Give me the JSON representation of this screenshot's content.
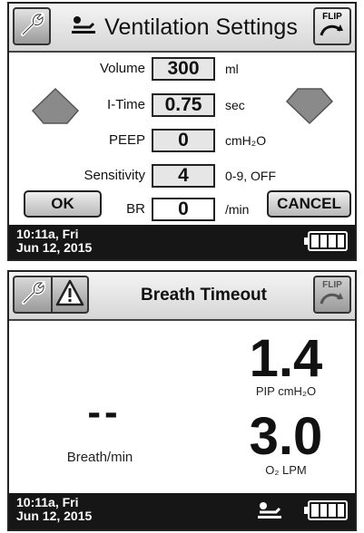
{
  "vent": {
    "title": "Ventilation Settings",
    "flip_label": "FLIP",
    "rows": [
      {
        "label": "Volume",
        "value": "300",
        "unit": "ml"
      },
      {
        "label": "I-Time",
        "value": "0.75",
        "unit": "sec"
      },
      {
        "label": "PEEP",
        "value": "0",
        "unit": "cmH₂O"
      },
      {
        "label": "Sensitivity",
        "value": "4",
        "unit": "0-9, OFF"
      },
      {
        "label": "BR",
        "value": "0",
        "unit": "/min"
      }
    ],
    "ok_label": "OK",
    "cancel_label": "CANCEL",
    "footer": {
      "time": "10:11a, Fri",
      "date": "Jun 12, 2015"
    }
  },
  "alarm": {
    "title": "Breath Timeout",
    "flip_label": "FLIP",
    "breath_rate": {
      "value": "--",
      "label": "Breath/min"
    },
    "pip": {
      "value": "1.4",
      "label": "PIP  cmH₂O"
    },
    "o2": {
      "value": "3.0",
      "label": "O₂  LPM"
    },
    "footer": {
      "time": "10:11a, Fri",
      "date": "Jun 12, 2015"
    }
  },
  "icons": [
    "wrench-icon",
    "patient-icon",
    "flip-icon",
    "arrow-up-icon",
    "arrow-down-icon",
    "warning-icon",
    "battery-icon"
  ],
  "colors": {
    "panel": "#ffffff",
    "footer": "#161616",
    "button": "#cfcfcf",
    "border": "#222222"
  }
}
